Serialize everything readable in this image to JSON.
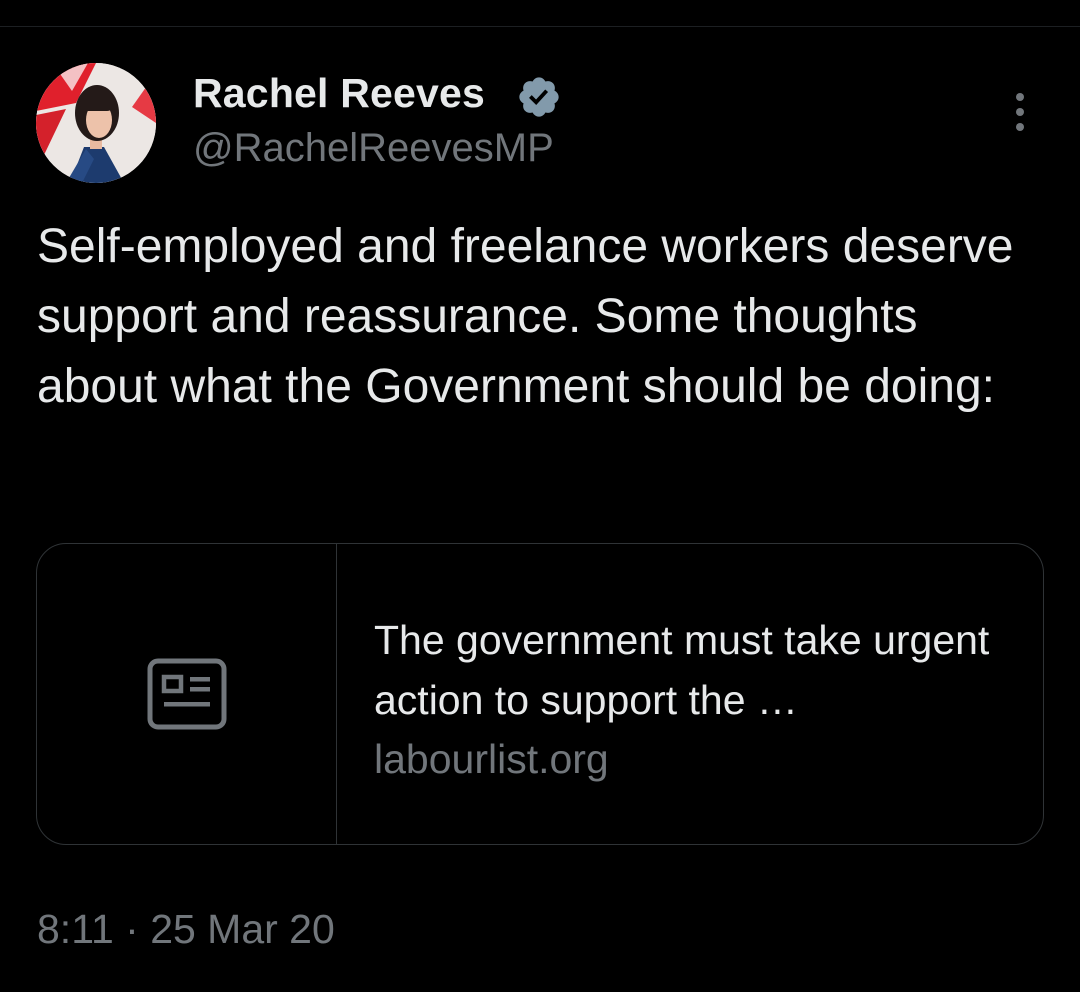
{
  "author": {
    "display_name": "Rachel Reeves",
    "handle": "@RachelReevesMP",
    "verified": true
  },
  "tweet": {
    "text": "Self-employed and freelance workers deserve support and reassurance. Some thoughts about what the Government should be doing:",
    "timestamp": "8:11 · 25 Mar 20"
  },
  "link_card": {
    "title": "The government must take urgent action to support the …",
    "domain": "labourlist.org",
    "thumbnail_icon": "news-article-icon"
  },
  "icons": {
    "verified": "verified-badge-icon",
    "more": "more-options-icon"
  },
  "colors": {
    "background": "#000000",
    "text_primary": "#e7e9ea",
    "text_secondary": "#71767b",
    "border": "#2f3336",
    "verified_badge": "#829aab"
  }
}
